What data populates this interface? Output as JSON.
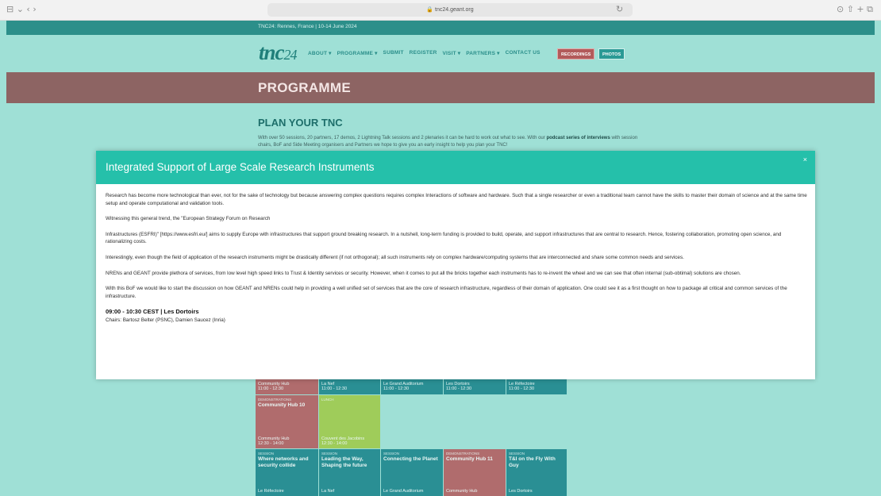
{
  "browser": {
    "url": "tnc24.geant.org",
    "controls_left": "⊟ ⌄   ‹  ›",
    "controls_right": "⊙  ⇧  +  ⧉",
    "reload": "↻"
  },
  "site": {
    "top_bar": "TNC24: Rennes, France | 10-14 June 2024",
    "logo_main": "tnc",
    "logo_year": "24",
    "menu": [
      "ABOUT ▾",
      "PROGRAMME ▾",
      "SUBMIT",
      "REGISTER",
      "VISIT ▾",
      "PARTNERS ▾",
      "CONTACT US"
    ],
    "recordings_label": "RECORDINGS",
    "photos_label": "PHOTOS",
    "banner_title": "PROGRAMME",
    "plan_title": "PLAN YOUR TNC",
    "plan_text_1": "With over 50 sessions, 20 partners, 17 demos, 2 Lightning Talk sessions and 2 plenaries it can be hard to work out what to see. With our",
    "plan_text_bold": "podcast series of interviews",
    "plan_text_2": "with session chairs, BoF and Side Meeting organisers and Partners we hope to give you an early insight to help you plan your TNC!"
  },
  "schedule": {
    "row1": [
      {
        "loc": "Community Hub",
        "time": "11:00 - 12:30"
      },
      {
        "loc": "La Nef",
        "time": "11:00 - 12:30"
      },
      {
        "loc": "Le Grand Auditorium",
        "time": "11:00 - 12:30"
      },
      {
        "loc": "Les Dortoirs",
        "time": "11:00 - 12:30"
      },
      {
        "loc": "Le Réfectoire",
        "time": "11:00 - 12:30"
      }
    ],
    "row2": [
      {
        "lbl": "DEMONSTRATIONS",
        "ttl": "Community Hub 10",
        "loc": "Community Hub",
        "time": "12:30 - 14:00"
      },
      {
        "lbl": "LUNCH",
        "ttl": "",
        "loc": "Couvent des Jacobins",
        "time": "12:30 - 14:00"
      }
    ],
    "row3": [
      {
        "lbl": "SESSION",
        "ttl": "Where networks and security collide",
        "loc": "Le Réfectoire"
      },
      {
        "lbl": "SESSION",
        "ttl": "Leading the Way, Shaping the future",
        "loc": "La Nef"
      },
      {
        "lbl": "SESSION",
        "ttl": "Connecting the Planet",
        "loc": "Le Grand Auditorium"
      },
      {
        "lbl": "DEMONSTRATIONS",
        "ttl": "Community Hub 11",
        "loc": "Community Hub"
      },
      {
        "lbl": "SESSION",
        "ttl": "T&I on the Fly With Guy",
        "loc": "Les Dortoirs"
      }
    ]
  },
  "modal": {
    "title": "Integrated Support of Large Scale Research Instruments",
    "close": "×",
    "paragraphs": [
      "Research has become more technological than ever, not for the sake of technology but because answering complex questions requires complex Interactions of software and hardware. Such that a single researcher or even a traditional team cannot have the skills to master their domain of science and at the same time setup and operate computational and validation tools.",
      "Witnessing this general trend, the \"European Strategy Forum on Research",
      "Infrastructures (ESFRI)\" [https://www.esfri.eu/] aims to supply Europe with infrastructures that support ground breaking research. In a nutshell, long-term funding is provided to build, operate, and support infrastructures that are central to research. Hence, fostering collaboration, promoting open science, and rationalizing costs.",
      "Interestingly, even though the field of application of the research instruments might be drastically different (if not orthogonal); all such instruments rely on complex hardware/computing systems that are interconnected and share some common needs and services.",
      "NRENs and GEANT provide plethora of services, from low level high speed links to Trust & Identity services or security. However, when it comes to put all the bricks together each instruments has to re-invent the wheel and we can see that often internal (sub-obtimal) solutions are chosen.",
      "With this BoF we would like to start the discussion on how GEANT and NRENs could help in providing a well unified set of services that are the core of research infrastructure, regardless of their domain of application. One could see it as a first thought on how to package all critical and common services of the infrastructure."
    ],
    "time_location": "09:00 - 10:30 CEST | Les Dortoirs",
    "chairs": "Chairs: Bartosz Belter (PSNC), Damien Saucez (Inria)"
  }
}
